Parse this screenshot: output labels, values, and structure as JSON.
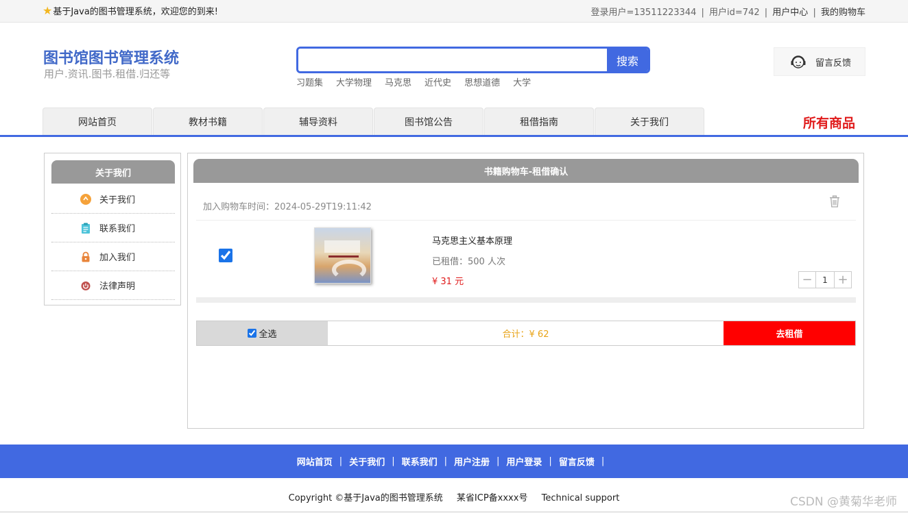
{
  "topbar": {
    "welcome": "基于Java的图书管理系统，欢迎您的到来!",
    "user_info": "登录用户=13511223344",
    "user_id": "用户id=742",
    "user_center": "用户中心",
    "cart": "我的购物车",
    "separator": "|"
  },
  "header": {
    "title": "图书馆图书管理系统",
    "subtitle": "用户.资讯.图书.租借.归还等",
    "search_placeholder": "",
    "search_button": "搜索",
    "hot_words": [
      "习题集",
      "大学物理",
      "马克思",
      "近代史",
      "思想道德",
      "大学"
    ],
    "feedback": "留言反馈"
  },
  "nav": {
    "tabs": [
      "网站首页",
      "教材书籍",
      "辅导资料",
      "图书馆公告",
      "租借指南",
      "关于我们"
    ],
    "all_goods": "所有商品"
  },
  "sidebar": {
    "title": "关于我们",
    "items": [
      {
        "label": "关于我们",
        "icon": "info-icon",
        "color": "#f5a23a"
      },
      {
        "label": "联系我们",
        "icon": "clipboard-icon",
        "color": "#4cc3d9"
      },
      {
        "label": "加入我们",
        "icon": "lock-icon",
        "color": "#e8843a"
      },
      {
        "label": "法律声明",
        "icon": "power-icon",
        "color": "#c0504d"
      }
    ]
  },
  "cart": {
    "title": "书籍购物车-租借确认",
    "added_time": "加入购物车时间：2024-05-29T19:11:42",
    "item": {
      "checked": true,
      "name": "马克思主义基本原理",
      "rented": "已租借：500 人次",
      "price": "¥ 31 元",
      "quantity": "1"
    },
    "select_all": "全选",
    "total": "合计：¥ 62",
    "checkout": "去租借"
  },
  "footer": {
    "links": [
      "网站首页",
      "关于我们",
      "联系我们",
      "用户注册",
      "用户登录",
      "留言反馈"
    ],
    "separator": "|",
    "copyright": "Copyright ©基于Java的图书管理系统",
    "icp": "某省ICP备xxxx号",
    "support": "Technical support",
    "watermark": "CSDN @黄菊华老师"
  },
  "colors": {
    "primary": "#4169e1",
    "title_blue": "#4169c8",
    "danger": "#ff0000",
    "total": "#e8a317",
    "header_gray": "#999999"
  }
}
